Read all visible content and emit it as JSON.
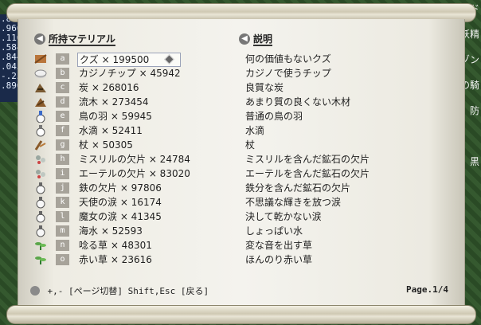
{
  "left_panel": {
    "lines": [
      ".8",
      ".966",
      ".116",
      ".584",
      ".844",
      ".045",
      "-.251",
      ".896"
    ]
  },
  "right_panel": {
    "lines": [
      "ド",
      "妖精",
      "ゾン",
      "の騎",
      "防",
      "黒"
    ]
  },
  "headers": {
    "material": "所持マテリアル",
    "description": "説明"
  },
  "items": [
    {
      "key": "a",
      "label": "クズ × 199500",
      "desc": "何の価値もないクズ",
      "icon": "scrap-icon",
      "selected": true
    },
    {
      "key": "b",
      "label": "カジノチップ × 45942",
      "desc": "カジノで使うチップ",
      "icon": "casino-chip-icon"
    },
    {
      "key": "c",
      "label": "炭 × 268016",
      "desc": "良質な炭",
      "icon": "charcoal-icon"
    },
    {
      "key": "d",
      "label": "流木 × 273454",
      "desc": "あまり質の良くない木材",
      "icon": "driftwood-icon"
    },
    {
      "key": "e",
      "label": "鳥の羽 × 59945",
      "desc": "普通の鳥の羽",
      "icon": "feather-icon"
    },
    {
      "key": "f",
      "label": "水滴 × 52411",
      "desc": "水滴",
      "icon": "water-flask-icon"
    },
    {
      "key": "g",
      "label": "杖 × 50305",
      "desc": "杖",
      "icon": "staff-icon"
    },
    {
      "key": "h",
      "label": "ミスリルの欠片 × 24784",
      "desc": "ミスリルを含んだ鉱石の欠片",
      "icon": "ore-icon"
    },
    {
      "key": "i",
      "label": "エーテルの欠片 × 83020",
      "desc": "エーテルを含んだ鉱石の欠片",
      "icon": "ore-icon"
    },
    {
      "key": "j",
      "label": "鉄の欠片 × 97806",
      "desc": "鉄分を含んだ鉱石の欠片",
      "icon": "potion-flask-icon"
    },
    {
      "key": "k",
      "label": "天使の涙 × 16174",
      "desc": "不思議な輝きを放つ涙",
      "icon": "potion-flask-icon"
    },
    {
      "key": "l",
      "label": "魔女の涙 × 41345",
      "desc": "決して乾かない涙",
      "icon": "potion-flask-icon"
    },
    {
      "key": "m",
      "label": "海水 × 52593",
      "desc": "しょっぱい水",
      "icon": "potion-flask-icon"
    },
    {
      "key": "n",
      "label": "唸る草 × 48301",
      "desc": "変な音を出す草",
      "icon": "herb-icon"
    },
    {
      "key": "o",
      "label": "赤い草 × 23616",
      "desc": "ほんのり赤い草",
      "icon": "herb-icon"
    }
  ],
  "footer": {
    "hint": "+,- [ページ切替] Shift,Esc [戻る]",
    "page": "Page.1/4"
  }
}
